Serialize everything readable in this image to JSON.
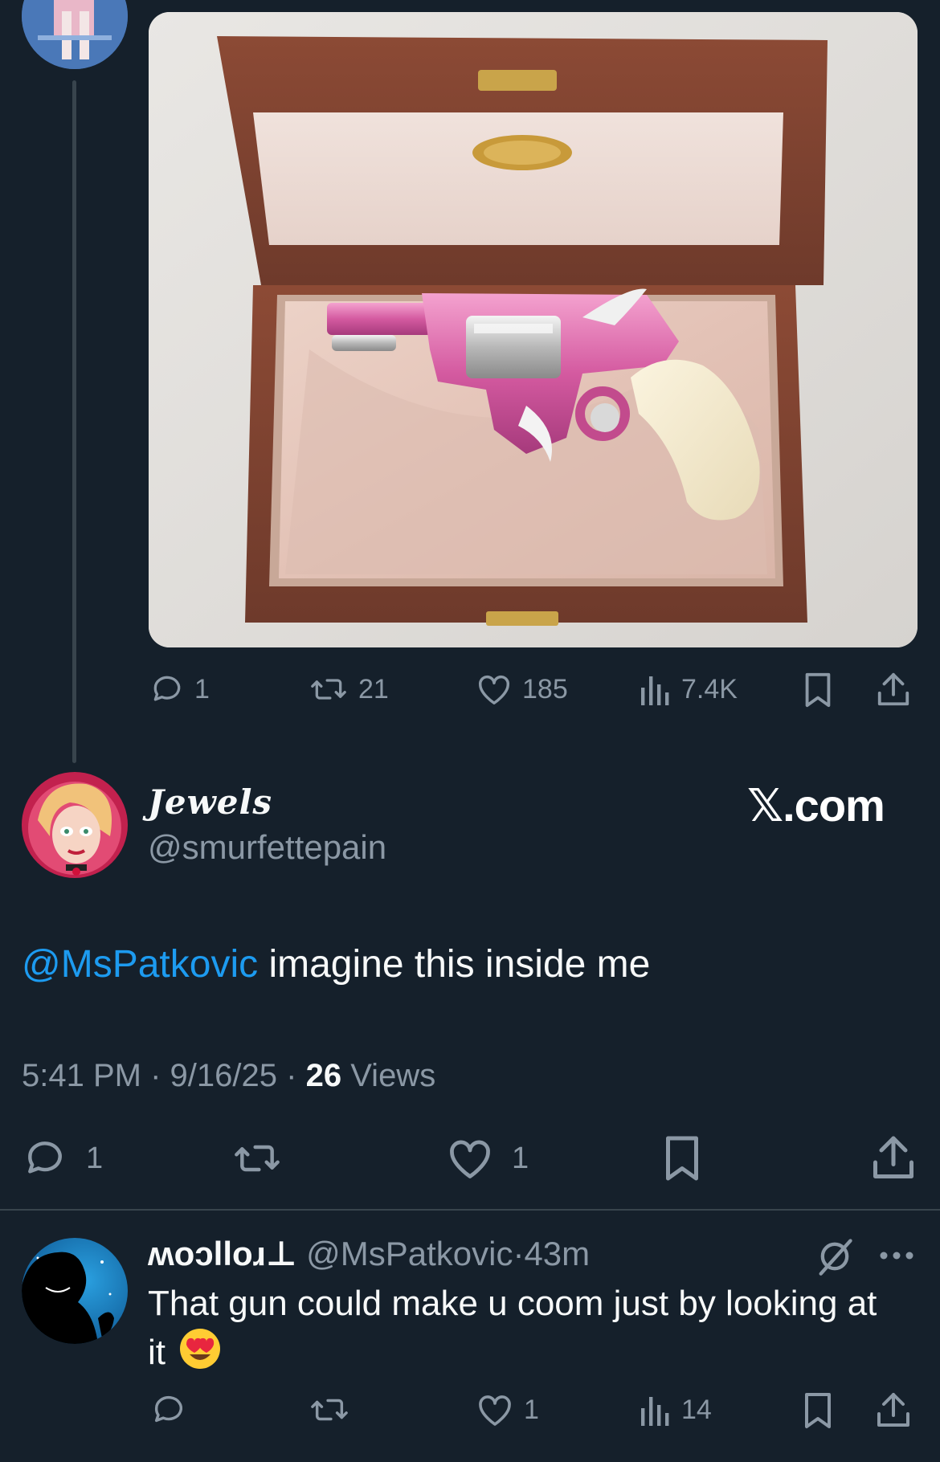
{
  "parent_tweet": {
    "media": {
      "description_icon": "photo-pink-revolver-in-wooden-case"
    },
    "actions": {
      "replies": "1",
      "reposts": "21",
      "likes": "185",
      "views": "7.4K"
    }
  },
  "focused_tweet": {
    "display_name": "Jewels",
    "handle": "@smurfettepain",
    "watermark": "𝕏.com",
    "mention": "@MsPatkovic",
    "text": " imagine this inside me",
    "time": "5:41 PM",
    "date": "9/16/25",
    "views_count": "26",
    "views_label": "Views",
    "sep": "·",
    "actions": {
      "replies": "1",
      "reposts": "",
      "likes": "1"
    }
  },
  "reply_tweet": {
    "display_name": "ʍoɔlloɹ⊥",
    "handle": "@MsPatkovic",
    "sep": "·",
    "time": "43m",
    "text_line1": "That gun could make u coom just by looking at",
    "text_line2": "it",
    "emoji": "😍",
    "actions": {
      "replies": "",
      "reposts": "",
      "likes": "1",
      "views": "14"
    }
  },
  "colors": {
    "background": "#15202b",
    "accent": "#1d9bf0",
    "muted": "#8b98a5",
    "text": "#f7f9f9",
    "divider": "#38444d"
  }
}
